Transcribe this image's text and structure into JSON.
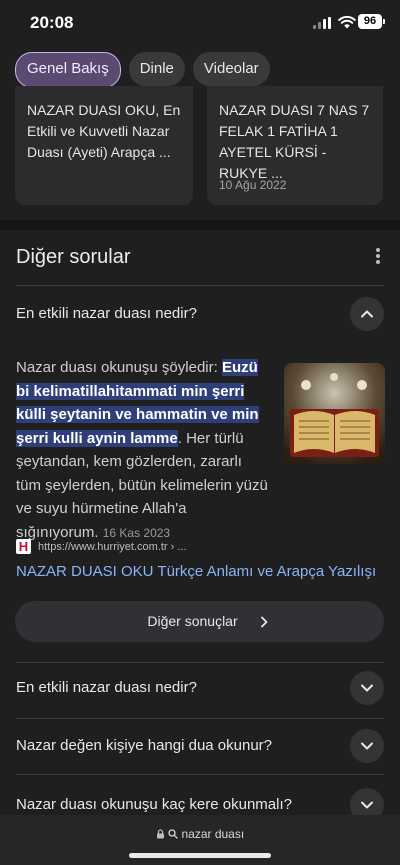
{
  "status_bar": {
    "time": "20:08",
    "battery": "96"
  },
  "tabs": [
    {
      "label": "Genel Bakış",
      "active": true
    },
    {
      "label": "Dinle",
      "active": false
    },
    {
      "label": "Videolar",
      "active": false
    }
  ],
  "cards": [
    {
      "title": "NAZAR DUASI OKU, En Etkili ve Kuvvetli Nazar Duası (Ayeti) Arapça ...",
      "date": ""
    },
    {
      "title": "NAZAR DUASI 7 NAS 7 FELAK 1 FATİHA 1 AYETEL KÜRSİ - RUKYE ...",
      "date": "10 Ağu 2022"
    }
  ],
  "other_questions": {
    "title": "Diğer sorular",
    "expanded": {
      "question": "En etkili nazar duası nedir?",
      "answer_intro": "Nazar duası okunuşu şöyledir: ",
      "answer_highlight": "Euzü bi kelimatillahitammati min şerri külli şeytanin ve hammatin ve min şerri kulli aynin lamme",
      "answer_rest": ". Her türlü şeytandan, kem gözlerden, zararlı tüm şeylerden, bütün kelimelerin yüzü ve suyu hürmetine Allah'a sığınıyorum.",
      "answer_date": "16 Kas 2023",
      "source_url": "https://www.hurriyet.com.tr › ...",
      "source_link": "NAZAR DUASI OKU Türkçe Anlamı ve Arapça Yazılışı"
    },
    "more_results": "Diğer sonuçlar",
    "questions": [
      "En etkili nazar duası nedir?",
      "Nazar değen kişiye hangi dua okunur?",
      "Nazar duası okunuşu kaç kere okunmalı?"
    ]
  },
  "address_bar": {
    "text": "nazar duası"
  },
  "colors": {
    "background": "#1f1f1f",
    "link": "#8ab4f8",
    "highlight": "#2f3f7a",
    "active_chip": "#5a4a72"
  }
}
